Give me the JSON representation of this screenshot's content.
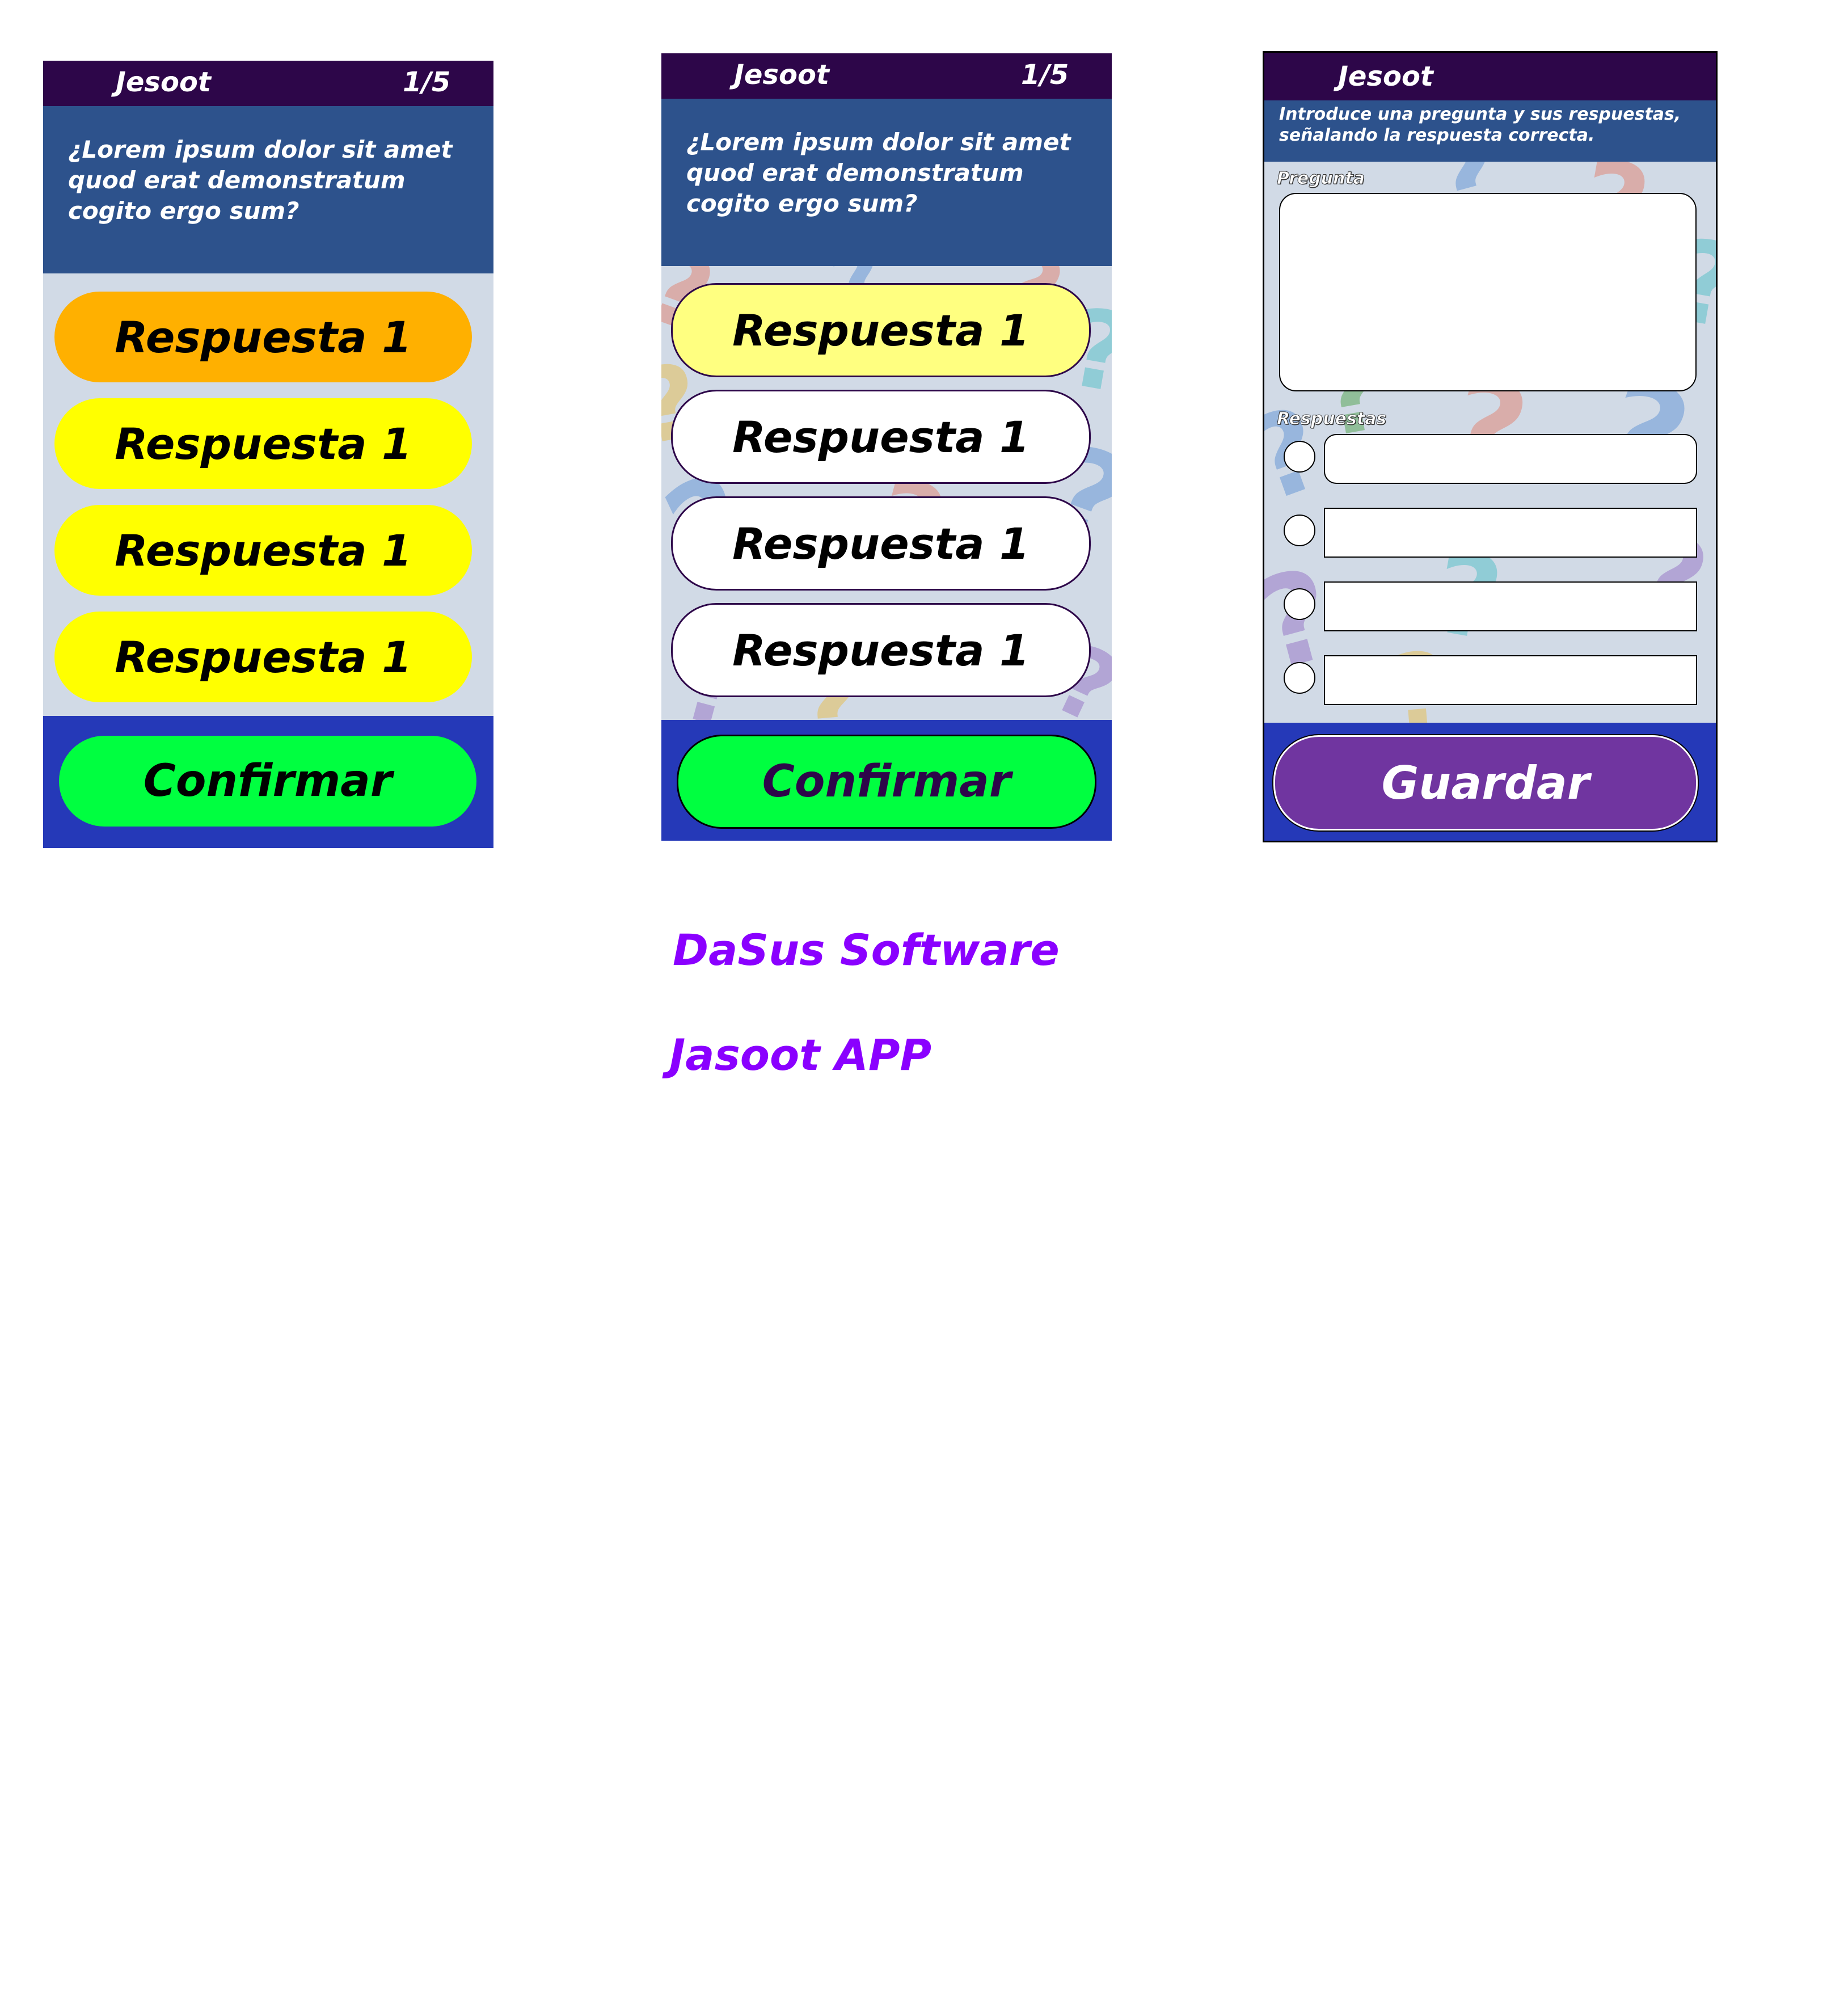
{
  "screens": {
    "s1": {
      "app_title": "Jesoot",
      "counter": "1/5",
      "question": "¿Lorem ipsum dolor sit amet\nquod erat demonstratum\ncogito ergo sum?",
      "answers": [
        "Respuesta 1",
        "Respuesta 1",
        "Respuesta 1",
        "Respuesta 1"
      ],
      "confirm_label": "Confirmar"
    },
    "s2": {
      "app_title": "Jesoot",
      "counter": "1/5",
      "question": "¿Lorem ipsum dolor sit amet\nquod erat demonstratum\ncogito ergo sum?",
      "answers": [
        "Respuesta 1",
        "Respuesta 1",
        "Respuesta 1",
        "Respuesta 1"
      ],
      "confirm_label": "Confirmar"
    },
    "s3": {
      "app_title": "Jesoot",
      "instruction": "Introduce una pregunta y sus respuestas,\nseñalando la respuesta correcta.",
      "question_label": "Pregunta",
      "answers_label": "Respuestas",
      "question_value": "",
      "answer_values": [
        "",
        "",
        "",
        ""
      ],
      "save_label": "Guardar"
    }
  },
  "footer": {
    "company": "DaSus Software",
    "product": "Jasoot APP"
  },
  "colors": {
    "top_bar": "#2d0649",
    "question_bg": "#2d528c",
    "answers_bg": "#d1dae6",
    "bottom_bar": "#2539b8",
    "selected_answer": "#ffb000",
    "answer_yellow": "#ffff00",
    "answer_light_yellow": "#ffff80",
    "confirm_green": "#00ff40",
    "save_purple": "#7035a0",
    "footer_purple": "#8a00ff"
  }
}
